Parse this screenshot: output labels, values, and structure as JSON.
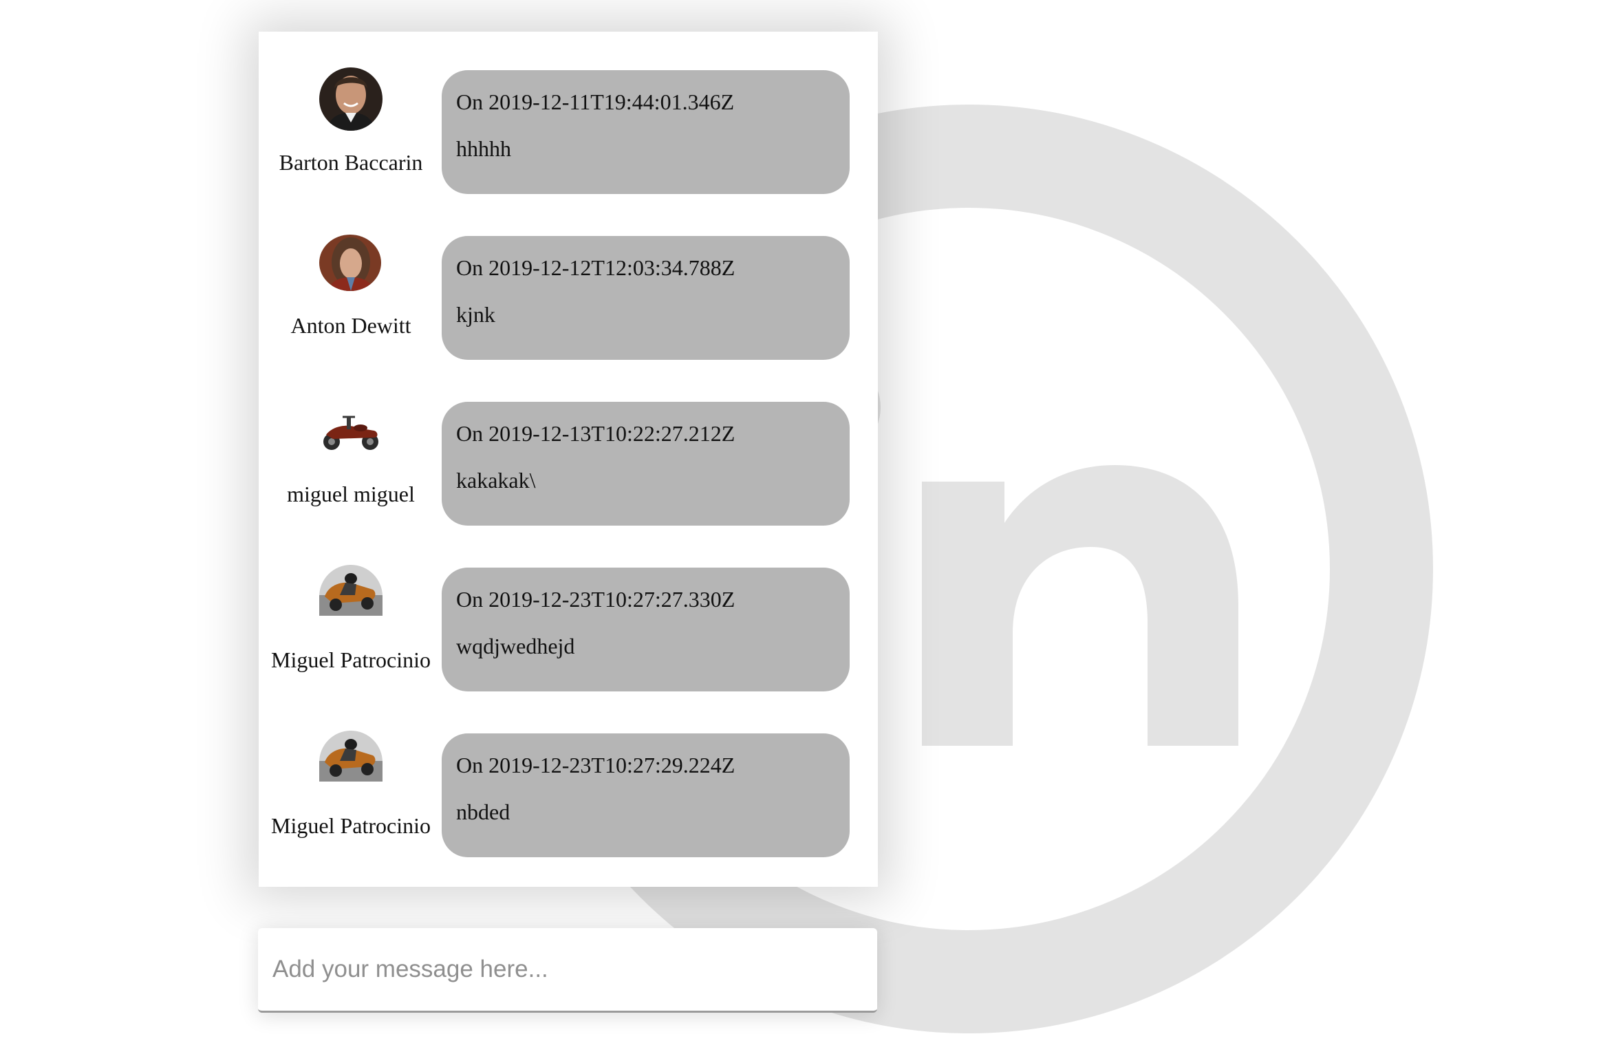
{
  "theme": {
    "bubble_color": "#a0a0a0",
    "watermark_color": "#e3e3e3",
    "text_color": "#111111"
  },
  "watermark": {
    "logo_text": "in",
    "icon": "linkedin-circle-logo"
  },
  "messages": [
    {
      "author": "Barton Baccarin",
      "avatar_icon": "portrait-photo-man-smiling",
      "date": "On 2019-12-11T19:44:01.346Z",
      "text": "hhhhh"
    },
    {
      "author": "Anton Dewitt",
      "avatar_icon": "portrait-photo-long-hair",
      "date": "On 2019-12-12T12:03:34.788Z",
      "text": "kjnk"
    },
    {
      "author": "miguel miguel",
      "avatar_icon": "sidecar-motorcycle-photo",
      "date": "On 2019-12-13T10:22:27.212Z",
      "text": "kakakak\\"
    },
    {
      "author": "Miguel Patrocinio",
      "avatar_icon": "sidecar-racing-photo",
      "date": "On 2019-12-23T10:27:27.330Z",
      "text": "wqdjwedhejd"
    },
    {
      "author": "Miguel Patrocinio",
      "avatar_icon": "sidecar-racing-photo",
      "date": "On 2019-12-23T10:27:29.224Z",
      "text": "nbded"
    }
  ],
  "composer": {
    "placeholder": "Add your message here...",
    "value": ""
  }
}
